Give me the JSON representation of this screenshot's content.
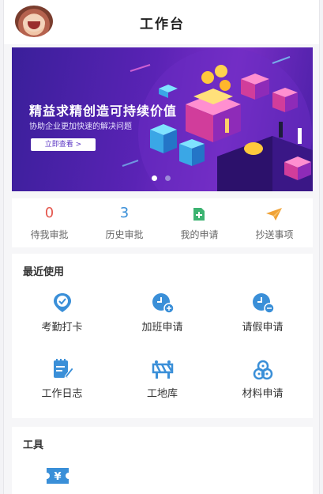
{
  "header": {
    "title": "工作台"
  },
  "banner": {
    "title": "精益求精创造可持续价值",
    "subtitle": "协助企业更加快速的解决问题",
    "button_label": "立即查看 >"
  },
  "stats": [
    {
      "value": "0",
      "label": "待我审批",
      "color": "#e4574e"
    },
    {
      "value": "3",
      "label": "历史审批",
      "color": "#3a8fd8"
    },
    {
      "label": "我的申请",
      "icon": "add-document-icon",
      "color": "#3cb371"
    },
    {
      "label": "抄送事项",
      "icon": "paper-plane-icon",
      "color": "#f0a236"
    }
  ],
  "recent": {
    "title": "最近使用",
    "items": [
      {
        "label": "考勤打卡",
        "icon": "location-check-icon"
      },
      {
        "label": "加班申请",
        "icon": "clock-plus-icon"
      },
      {
        "label": "请假申请",
        "icon": "clock-minus-icon"
      },
      {
        "label": "工作日志",
        "icon": "notebook-edit-icon"
      },
      {
        "label": "工地库",
        "icon": "construction-barrier-icon"
      },
      {
        "label": "材料申请",
        "icon": "materials-stack-icon"
      }
    ]
  },
  "tools": {
    "title": "工具",
    "items": [
      {
        "icon": "yuan-ticket-icon"
      }
    ]
  },
  "colors": {
    "accent": "#3a8fd8",
    "banner_bg": "#4e22b0"
  }
}
